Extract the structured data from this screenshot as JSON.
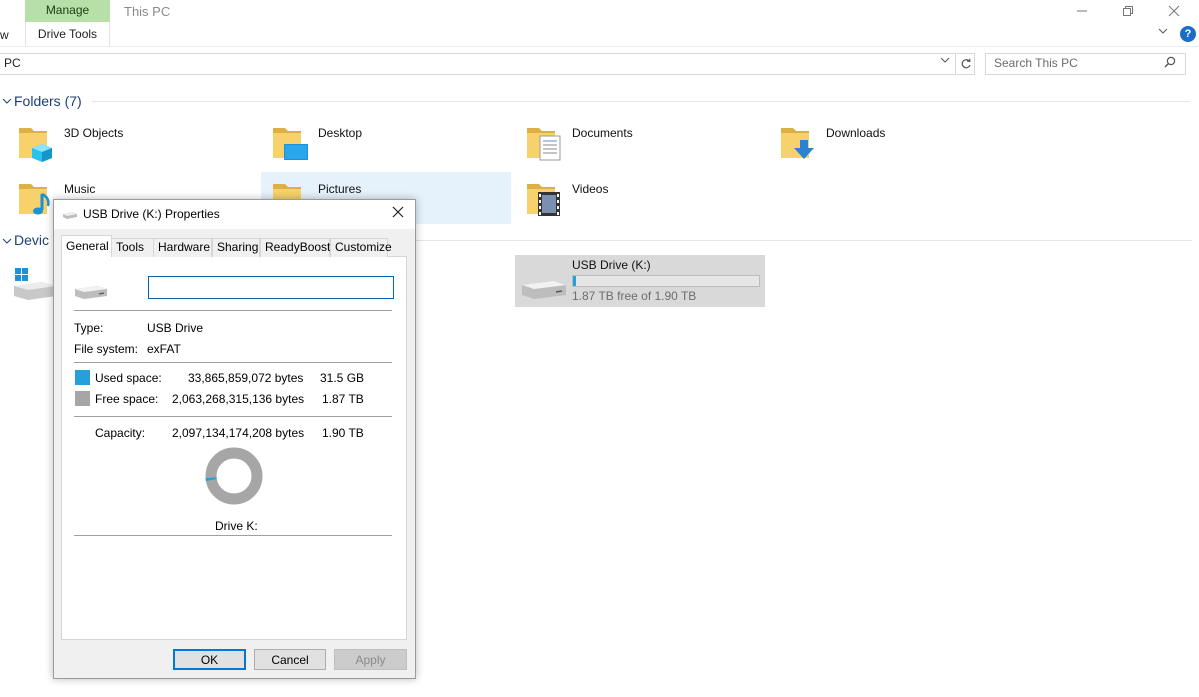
{
  "ribbon": {
    "manage_tab": "Manage",
    "drive_tools_tab": "Drive Tools",
    "view_tab_partial": "w",
    "window_title": "This PC"
  },
  "address_bar": {
    "path": "PC",
    "search_placeholder": "Search This PC"
  },
  "sections": {
    "folders_title": "Folders (7)",
    "devices_title_partial": "Devic"
  },
  "folders": [
    {
      "label": "3D Objects",
      "icon": "3d-objects-icon"
    },
    {
      "label": "Desktop",
      "icon": "desktop-icon"
    },
    {
      "label": "Documents",
      "icon": "documents-icon"
    },
    {
      "label": "Downloads",
      "icon": "downloads-icon"
    },
    {
      "label": "Music",
      "icon": "music-icon"
    },
    {
      "label": "Pictures",
      "icon": "pictures-icon"
    },
    {
      "label": "Videos",
      "icon": "videos-icon"
    }
  ],
  "usb_drive": {
    "name": "USB Drive (K:)",
    "free_text": "1.87 TB free of 1.90 TB",
    "used_fraction": 0.017
  },
  "dialog": {
    "title": "USB Drive (K:) Properties",
    "tabs": [
      "General",
      "Tools",
      "Hardware",
      "Sharing",
      "ReadyBoost",
      "Customize"
    ],
    "active_tab": "General",
    "name_value": "",
    "type_label": "Type:",
    "type_value": "USB Drive",
    "fs_label": "File system:",
    "fs_value": "exFAT",
    "used_label": "Used space:",
    "used_bytes": "33,865,859,072 bytes",
    "used_short": "31.5 GB",
    "free_label": "Free space:",
    "free_bytes": "2,063,268,315,136 bytes",
    "free_short": "1.87 TB",
    "capacity_label": "Capacity:",
    "capacity_bytes": "2,097,134,174,208 bytes",
    "capacity_short": "1.90 TB",
    "drive_label": "Drive K:",
    "used_fraction": 0.016,
    "ok": "OK",
    "cancel": "Cancel",
    "apply": "Apply"
  },
  "colors": {
    "used": "#26a0da",
    "free": "#a6a6a6",
    "manage_tab": "#b7dfa8",
    "section_text": "#1e3f76",
    "selection": "#e5f1fb"
  }
}
